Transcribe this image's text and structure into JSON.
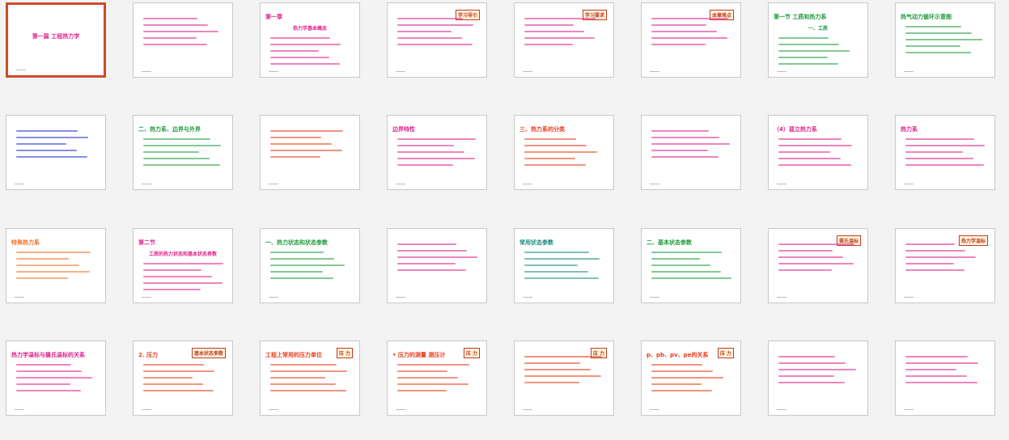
{
  "slides": [
    {
      "title": "第一篇  工程热力学",
      "color": "#e0218a",
      "selected": true
    },
    {
      "title": "",
      "color": "#e0218a"
    },
    {
      "title": "第一章",
      "subtitle": "热力学基本概念",
      "color": "#e0218a"
    },
    {
      "title": "",
      "tag": "学习导引",
      "color": "#e0218a"
    },
    {
      "title": "",
      "tag": "学习要求",
      "color": "#e0218a"
    },
    {
      "title": "",
      "tag": "本章难点",
      "color": "#e0218a"
    },
    {
      "title": "第一节  工质和热力系",
      "subtitle": "一、工质",
      "color": "#1f9a3e"
    },
    {
      "title": "热气动力循环示意图",
      "color": "#1f9a3e"
    },
    {
      "title": "",
      "color": "#2233cc"
    },
    {
      "title": "二、热力系、边界与外界",
      "color": "#1f9a3e"
    },
    {
      "title": "",
      "color": "#e83a1a"
    },
    {
      "title": "边界特性",
      "color": "#e0218a"
    },
    {
      "title": "三、热力系的分类",
      "color": "#e83a1a"
    },
    {
      "title": "",
      "color": "#e0218a"
    },
    {
      "title": "（4）孤立热力系",
      "color": "#e0218a"
    },
    {
      "title": "热力系",
      "color": "#e0218a"
    },
    {
      "title": "特殊热力系",
      "color": "#f07020"
    },
    {
      "title": "第二节",
      "subtitle": "工质的热力状态和基本状态参数",
      "color": "#e0218a"
    },
    {
      "title": "一、热力状态和状态参数",
      "color": "#1f9a3e"
    },
    {
      "title": "",
      "color": "#e0218a"
    },
    {
      "title": "常用状态参数",
      "color": "#1a8a7a"
    },
    {
      "title": "二、基本状态参数",
      "color": "#1f9a3e"
    },
    {
      "title": "",
      "tag": "摄氏温标",
      "color": "#e0218a"
    },
    {
      "title": "",
      "tag": "热力学温标",
      "color": "#e0218a"
    },
    {
      "title": "热力学温标与摄氏温标的关系",
      "color": "#e0218a"
    },
    {
      "title": "2. 压力",
      "tag": "基本状态参数",
      "color": "#e83a1a"
    },
    {
      "title": "工程上常用的压力单位",
      "tag": "压 力",
      "color": "#e83a1a"
    },
    {
      "title": "• 压力的测量  测压计",
      "tag": "压 力",
      "color": "#e83a1a"
    },
    {
      "title": "",
      "tag": "压 力",
      "color": "#e83a1a"
    },
    {
      "title": "p、pb、pv、pe的关系",
      "tag": "压 力",
      "color": "#e83a1a"
    },
    {
      "title": "",
      "color": "#e0218a"
    },
    {
      "title": "",
      "color": "#e0218a"
    }
  ]
}
